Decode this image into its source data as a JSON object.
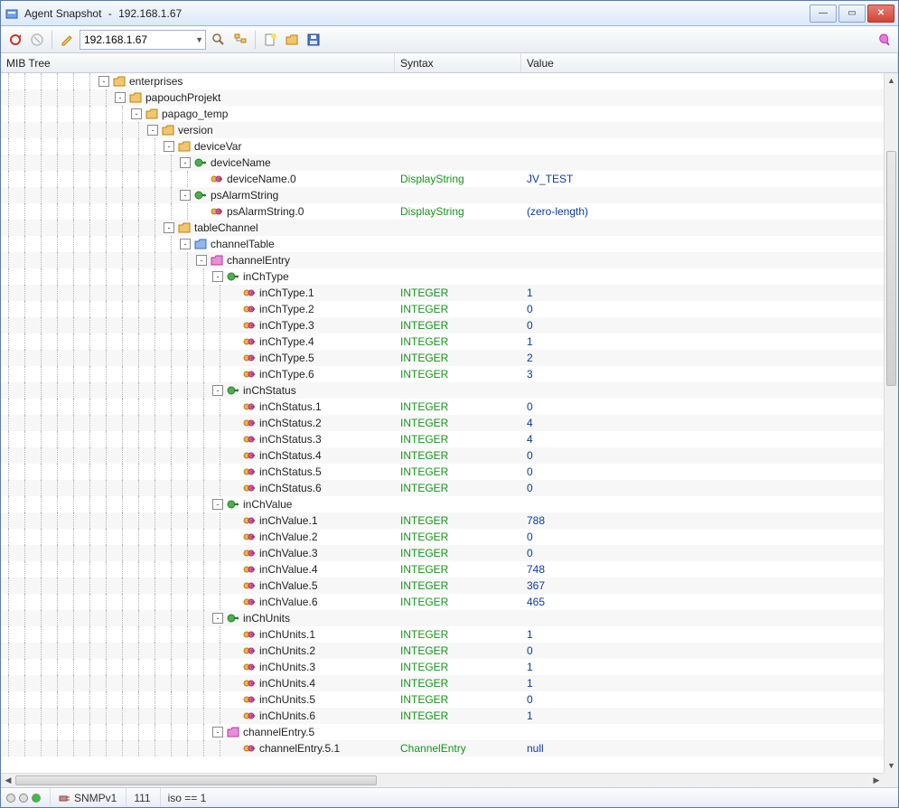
{
  "window": {
    "app_name": "Agent Snapshot",
    "host": "192.168.1.67"
  },
  "toolbar": {
    "address": "192.168.1.67"
  },
  "columns": {
    "tree": "MIB Tree",
    "syntax": "Syntax",
    "value": "Value"
  },
  "status": {
    "protocol": "SNMPv1",
    "count": "111",
    "path": "iso == 1"
  },
  "syntax": {
    "DisplayString": "DisplayString",
    "INTEGER": "INTEGER",
    "ChannelEntry": "ChannelEntry"
  },
  "rows": [
    {
      "depth": 6,
      "exp": "-",
      "icon": "folder",
      "label": "enterprises"
    },
    {
      "depth": 7,
      "exp": "-",
      "icon": "folder",
      "label": "papouchProjekt"
    },
    {
      "depth": 8,
      "exp": "-",
      "icon": "folder",
      "label": "papago_temp"
    },
    {
      "depth": 9,
      "exp": "-",
      "icon": "folder",
      "label": "version"
    },
    {
      "depth": 10,
      "exp": "-",
      "icon": "folder",
      "label": "deviceVar"
    },
    {
      "depth": 11,
      "exp": "-",
      "icon": "tag",
      "label": "deviceName"
    },
    {
      "depth": 12,
      "exp": "",
      "icon": "leaf",
      "label": "deviceName.0",
      "syntax": "DisplayString",
      "value": "JV_TEST"
    },
    {
      "depth": 11,
      "exp": "-",
      "icon": "tag",
      "label": "psAlarmString"
    },
    {
      "depth": 12,
      "exp": "",
      "icon": "leaf",
      "label": "psAlarmString.0",
      "syntax": "DisplayString",
      "value": "(zero-length)"
    },
    {
      "depth": 10,
      "exp": "-",
      "icon": "folder",
      "label": "tableChannel"
    },
    {
      "depth": 11,
      "exp": "-",
      "icon": "folderb",
      "label": "channelTable"
    },
    {
      "depth": 12,
      "exp": "-",
      "icon": "folderp",
      "label": "channelEntry"
    },
    {
      "depth": 13,
      "exp": "-",
      "icon": "tag",
      "label": "inChType"
    },
    {
      "depth": 14,
      "exp": "",
      "icon": "leaf",
      "label": "inChType.1",
      "syntax": "INTEGER",
      "value": "1"
    },
    {
      "depth": 14,
      "exp": "",
      "icon": "leaf",
      "label": "inChType.2",
      "syntax": "INTEGER",
      "value": "0"
    },
    {
      "depth": 14,
      "exp": "",
      "icon": "leaf",
      "label": "inChType.3",
      "syntax": "INTEGER",
      "value": "0"
    },
    {
      "depth": 14,
      "exp": "",
      "icon": "leaf",
      "label": "inChType.4",
      "syntax": "INTEGER",
      "value": "1"
    },
    {
      "depth": 14,
      "exp": "",
      "icon": "leaf",
      "label": "inChType.5",
      "syntax": "INTEGER",
      "value": "2"
    },
    {
      "depth": 14,
      "exp": "",
      "icon": "leaf",
      "label": "inChType.6",
      "syntax": "INTEGER",
      "value": "3"
    },
    {
      "depth": 13,
      "exp": "-",
      "icon": "tag",
      "label": "inChStatus"
    },
    {
      "depth": 14,
      "exp": "",
      "icon": "leaf",
      "label": "inChStatus.1",
      "syntax": "INTEGER",
      "value": "0"
    },
    {
      "depth": 14,
      "exp": "",
      "icon": "leaf",
      "label": "inChStatus.2",
      "syntax": "INTEGER",
      "value": "4"
    },
    {
      "depth": 14,
      "exp": "",
      "icon": "leaf",
      "label": "inChStatus.3",
      "syntax": "INTEGER",
      "value": "4"
    },
    {
      "depth": 14,
      "exp": "",
      "icon": "leaf",
      "label": "inChStatus.4",
      "syntax": "INTEGER",
      "value": "0"
    },
    {
      "depth": 14,
      "exp": "",
      "icon": "leaf",
      "label": "inChStatus.5",
      "syntax": "INTEGER",
      "value": "0"
    },
    {
      "depth": 14,
      "exp": "",
      "icon": "leaf",
      "label": "inChStatus.6",
      "syntax": "INTEGER",
      "value": "0"
    },
    {
      "depth": 13,
      "exp": "-",
      "icon": "tag",
      "label": "inChValue"
    },
    {
      "depth": 14,
      "exp": "",
      "icon": "leaf",
      "label": "inChValue.1",
      "syntax": "INTEGER",
      "value": "788"
    },
    {
      "depth": 14,
      "exp": "",
      "icon": "leaf",
      "label": "inChValue.2",
      "syntax": "INTEGER",
      "value": "0"
    },
    {
      "depth": 14,
      "exp": "",
      "icon": "leaf",
      "label": "inChValue.3",
      "syntax": "INTEGER",
      "value": "0"
    },
    {
      "depth": 14,
      "exp": "",
      "icon": "leaf",
      "label": "inChValue.4",
      "syntax": "INTEGER",
      "value": "748"
    },
    {
      "depth": 14,
      "exp": "",
      "icon": "leaf",
      "label": "inChValue.5",
      "syntax": "INTEGER",
      "value": "367"
    },
    {
      "depth": 14,
      "exp": "",
      "icon": "leaf",
      "label": "inChValue.6",
      "syntax": "INTEGER",
      "value": "465"
    },
    {
      "depth": 13,
      "exp": "-",
      "icon": "tag",
      "label": "inChUnits"
    },
    {
      "depth": 14,
      "exp": "",
      "icon": "leaf",
      "label": "inChUnits.1",
      "syntax": "INTEGER",
      "value": "1"
    },
    {
      "depth": 14,
      "exp": "",
      "icon": "leaf",
      "label": "inChUnits.2",
      "syntax": "INTEGER",
      "value": "0"
    },
    {
      "depth": 14,
      "exp": "",
      "icon": "leaf",
      "label": "inChUnits.3",
      "syntax": "INTEGER",
      "value": "1"
    },
    {
      "depth": 14,
      "exp": "",
      "icon": "leaf",
      "label": "inChUnits.4",
      "syntax": "INTEGER",
      "value": "1"
    },
    {
      "depth": 14,
      "exp": "",
      "icon": "leaf",
      "label": "inChUnits.5",
      "syntax": "INTEGER",
      "value": "0"
    },
    {
      "depth": 14,
      "exp": "",
      "icon": "leaf",
      "label": "inChUnits.6",
      "syntax": "INTEGER",
      "value": "1"
    },
    {
      "depth": 13,
      "exp": "-",
      "icon": "folderp",
      "label": "channelEntry.5"
    },
    {
      "depth": 14,
      "exp": "",
      "icon": "leaf",
      "label": "channelEntry.5.1",
      "syntax": "ChannelEntry",
      "value": "null"
    }
  ]
}
